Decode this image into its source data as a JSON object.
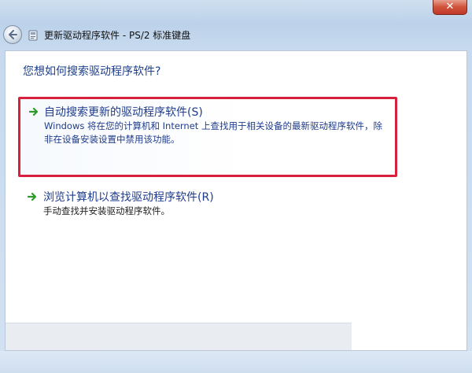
{
  "window": {
    "title": "更新驱动程序软件 - PS/2 标准键盘",
    "close_label": "✕"
  },
  "main": {
    "heading": "您想如何搜索驱动程序软件?",
    "options": [
      {
        "title": "自动搜索更新的驱动程序软件(S)",
        "description": "Windows 将在您的计算机和 Internet 上查找用于相关设备的最新驱动程序软件，除非在设备安装设置中禁用该功能。"
      },
      {
        "title": "浏览计算机以查找驱动程序软件(R)",
        "description": "手动查找并安装驱动程序软件。"
      }
    ]
  },
  "colors": {
    "highlight_border": "#d6203c",
    "link_text": "#1f3c8c",
    "arrow_green": "#2e9a2e"
  },
  "icons": [
    "back-arrow-icon",
    "device-icon",
    "close-icon",
    "green-arrow-icon"
  ]
}
